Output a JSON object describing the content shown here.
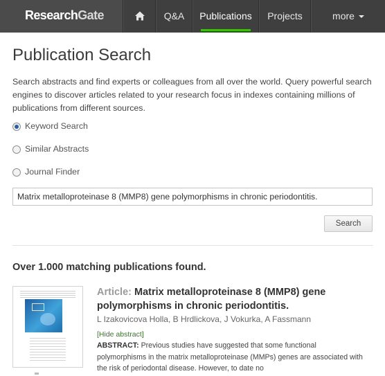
{
  "brand": {
    "part1": "Research",
    "part2": "Gate"
  },
  "nav": {
    "home_icon": "home-icon",
    "items": [
      {
        "label": "Q&A"
      },
      {
        "label": "Publications",
        "active": true
      },
      {
        "label": "Projects"
      },
      {
        "label": "more"
      }
    ]
  },
  "page": {
    "title": "Publication Search",
    "intro": "Search abstracts and find experts or colleagues from all over the world. Query powerful search engines to discover articles related to your research focus in indexes containing millions of publications from different sources."
  },
  "search_type": {
    "selected": "Keyword Search",
    "options": [
      {
        "label": "Keyword Search",
        "checked": true
      },
      {
        "label": "Similar Abstracts",
        "checked": false
      },
      {
        "label": "Journal Finder",
        "checked": false
      }
    ]
  },
  "search": {
    "query": "Matrix metalloproteinase 8 (MMP8) gene polymorphisms in chronic periodontitis.",
    "button_label": "Search"
  },
  "results": {
    "count_text": "Over 1.000 matching publications found.",
    "items": [
      {
        "type_label": "Article:",
        "title": "Matrix metalloproteinase 8 (MMP8) gene polymorphisms in chronic periodontitis.",
        "authors": "L Izakovicova Holla, B Hrdlickova, J Vokurka, A Fassmann",
        "toggle_label": "[Hide abstract]",
        "abstract_label": "ABSTRACT:",
        "abstract": "Previous studies have suggested that some functional polymorphisms in the matrix metalloproteinase (MMPs) genes are associated with the risk of periodontal disease. However, to date no"
      }
    ]
  },
  "colors": {
    "nav_background": "#3f3f3f",
    "active_underline": "#3cc200",
    "radio_selected": "#2a5db0",
    "hide_link": "#2f7d1e"
  }
}
